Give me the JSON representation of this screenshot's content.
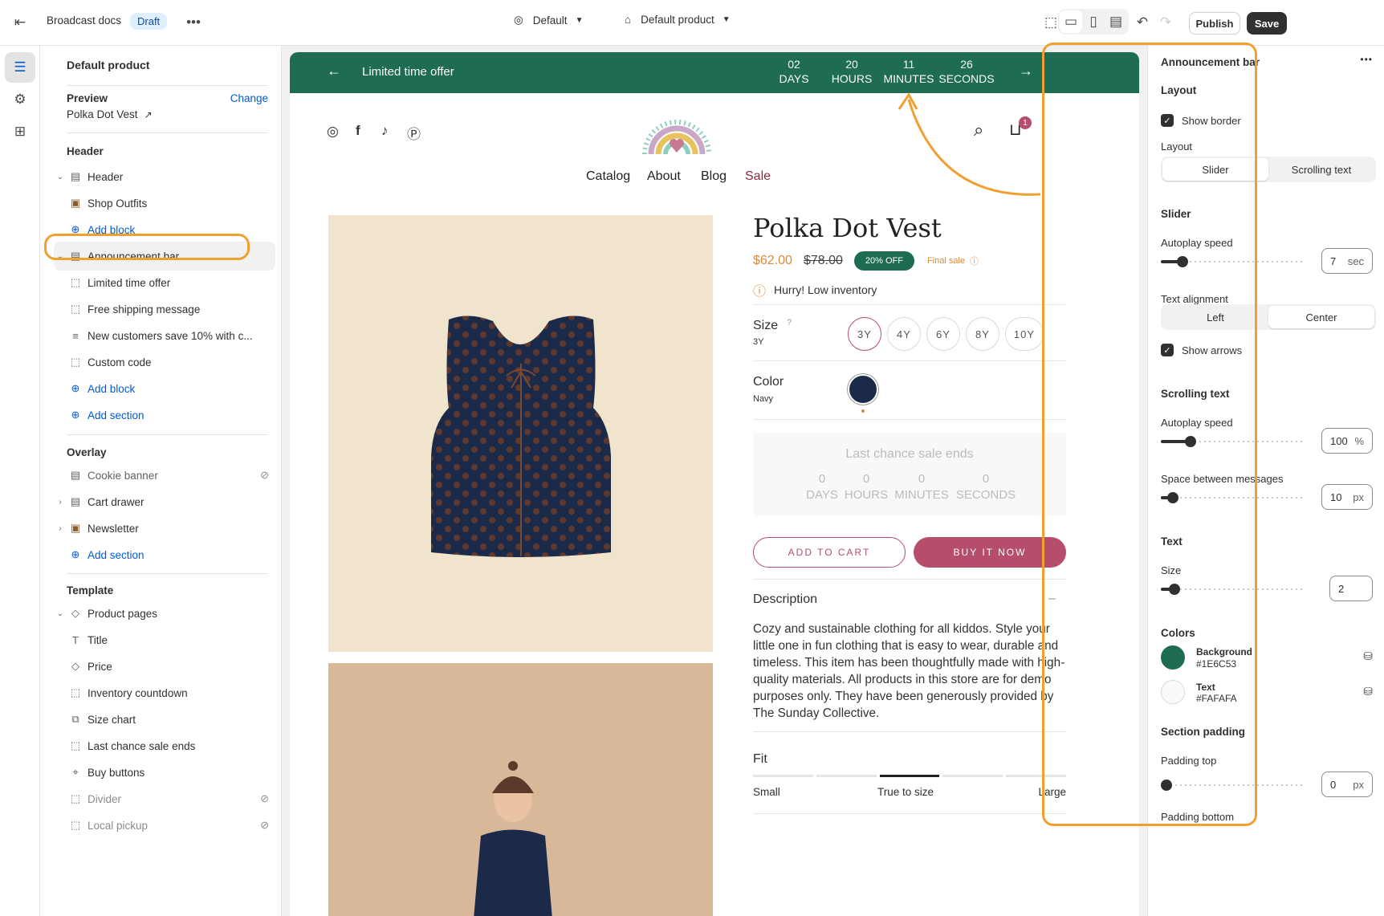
{
  "topbar": {
    "store_name": "Broadcast docs",
    "status_badge": "Draft",
    "theme_selector": "Default",
    "template_selector": "Default product",
    "publish_label": "Publish",
    "save_label": "Save"
  },
  "left": {
    "title": "Default product",
    "preview_label": "Preview",
    "preview_change": "Change",
    "preview_product": "Polka Dot Vest",
    "header_group": "Header",
    "header_section": "Header",
    "header_blocks": [
      "Shop Outfits"
    ],
    "add_block": "Add block",
    "announcement_section": "Announcement bar",
    "announcement_blocks": [
      "Limited time offer",
      "Free shipping message",
      "New customers save 10% with c...",
      "Custom code"
    ],
    "add_section": "Add section",
    "overlay_group": "Overlay",
    "overlay_items": [
      "Cookie banner",
      "Cart drawer",
      "Newsletter"
    ],
    "template_group": "Template",
    "template_section": "Product pages",
    "template_blocks": [
      "Title",
      "Price",
      "Inventory countdown",
      "Size chart",
      "Last chance sale ends",
      "Buy buttons",
      "Divider",
      "Local pickup"
    ]
  },
  "preview": {
    "announcement_text": "Limited time offer",
    "countdown": [
      {
        "value": "02",
        "unit": "DAYS"
      },
      {
        "value": "20",
        "unit": "HOURS"
      },
      {
        "value": "11",
        "unit": "MINUTES"
      },
      {
        "value": "26",
        "unit": "SECONDS"
      }
    ],
    "nav": [
      "Catalog",
      "About",
      "Blog",
      "Sale"
    ],
    "cart_count": "1",
    "product_title": "Polka Dot Vest",
    "price": "$62.00",
    "compare_price": "$78.00",
    "discount_badge": "20% OFF",
    "final_sale": "Final sale",
    "inventory_msg": "Hurry! Low inventory",
    "size_label": "Size",
    "size_value": "3Y",
    "sizes": [
      "3Y",
      "4Y",
      "6Y",
      "8Y",
      "10Y"
    ],
    "color_label": "Color",
    "color_value": "Navy",
    "sale_ends_title": "Last chance sale ends",
    "sale_countdown": [
      {
        "value": "0",
        "unit": "DAYS"
      },
      {
        "value": "0",
        "unit": "HOURS"
      },
      {
        "value": "0",
        "unit": "MINUTES"
      },
      {
        "value": "0",
        "unit": "SECONDS"
      }
    ],
    "add_to_cart": "ADD TO CART",
    "buy_now": "BUY IT NOW",
    "description_title": "Description",
    "description_text": "Cozy and sustainable clothing for all kiddos. Style your little one in fun clothing that is easy to wear, durable and timeless. This item has been thoughtfully made with high-quality materials. All products in this store are for demo purposes only. They have been generously provided by The Sunday Collective.",
    "fit_title": "Fit",
    "fit_small": "Small",
    "fit_true": "True to size",
    "fit_large": "Large"
  },
  "right": {
    "title": "Announcement bar",
    "layout_head": "Layout",
    "show_border": "Show border",
    "layout_label": "Layout",
    "layout_options": [
      "Slider",
      "Scrolling text"
    ],
    "slider_head": "Slider",
    "autoplay_label": "Autoplay speed",
    "autoplay_value": "7",
    "autoplay_unit": "sec",
    "text_align_label": "Text alignment",
    "align_options": [
      "Left",
      "Center"
    ],
    "show_arrows": "Show arrows",
    "scrolling_head": "Scrolling text",
    "scroll_autoplay_label": "Autoplay speed",
    "scroll_autoplay_value": "100",
    "scroll_autoplay_unit": "%",
    "space_label": "Space between messages",
    "space_value": "10",
    "space_unit": "px",
    "text_head": "Text",
    "size_label": "Size",
    "size_value": "2",
    "colors_head": "Colors",
    "bg_name": "Background",
    "bg_hex": "#1E6C53",
    "text_name": "Text",
    "text_hex": "#FAFAFA",
    "padding_head": "Section padding",
    "padding_top_label": "Padding top",
    "padding_top_value": "0",
    "padding_top_unit": "px",
    "padding_bottom_label": "Padding bottom"
  },
  "colors": {
    "accent_green": "#1E6C53",
    "buy_button": "#B54D6B",
    "highlight": "#F0A030"
  }
}
